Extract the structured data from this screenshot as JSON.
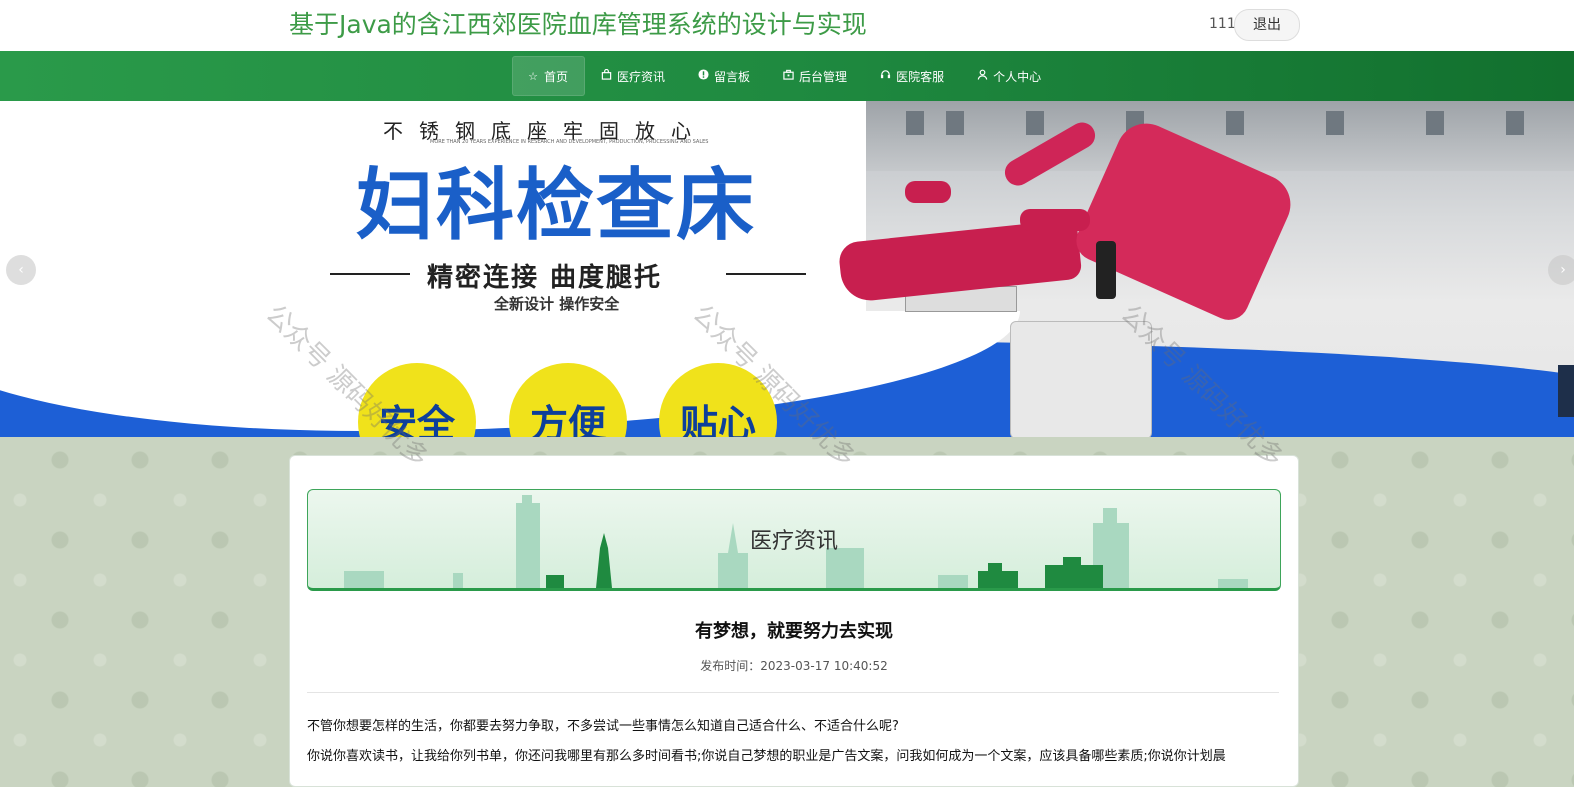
{
  "header": {
    "site_title": "基于Java的含江西郊医院血库管理系统的设计与实现",
    "user_name": "111",
    "logout_label": "退出"
  },
  "nav": {
    "items": [
      {
        "label": "首页",
        "icon": "star-icon"
      },
      {
        "label": "医疗资讯",
        "icon": "bag-icon"
      },
      {
        "label": "留言板",
        "icon": "info-icon"
      },
      {
        "label": "后台管理",
        "icon": "briefcase-icon"
      },
      {
        "label": "医院客服",
        "icon": "headset-icon"
      },
      {
        "label": "个人中心",
        "icon": "user-icon"
      }
    ],
    "active_index": 0
  },
  "banner": {
    "top_tagline": "不锈钢底座牢固放心",
    "small_tagline": "MORE THAN 20 YEARS EXPERIENCE IN RESEARCH AND DEVELOPMENT, PRODUCTION, PROCESSING AND SALES",
    "title": "妇科检查床",
    "subtitle": "精密连接 曲度腿托",
    "small_subtitle": "全新设计 操作安全",
    "circles": [
      "安全",
      "方便",
      "贴心"
    ]
  },
  "section": {
    "title": "医疗资讯"
  },
  "article": {
    "title": "有梦想，就要努力去实现",
    "publish_time": "发布时间：2023-03-17 10:40:52",
    "paragraph1": "不管你想要怎样的生活，你都要去努力争取，不多尝试一些事情怎么知道自己适合什么、不适合什么呢?",
    "paragraph2": "你说你喜欢读书，让我给你列书单，你还问我哪里有那么多时间看书;你说自己梦想的职业是广告文案，问我如何成为一个文案，应该具备哪些素质;你说你计划晨"
  },
  "watermark": "公众号 源码好优多",
  "colors": {
    "title_green": "#3d9b47",
    "nav_green": "#1f8a40",
    "banner_blue": "#1a5fc8",
    "circle_yellow": "#f0e21b",
    "chair_red": "#c81f4f"
  }
}
